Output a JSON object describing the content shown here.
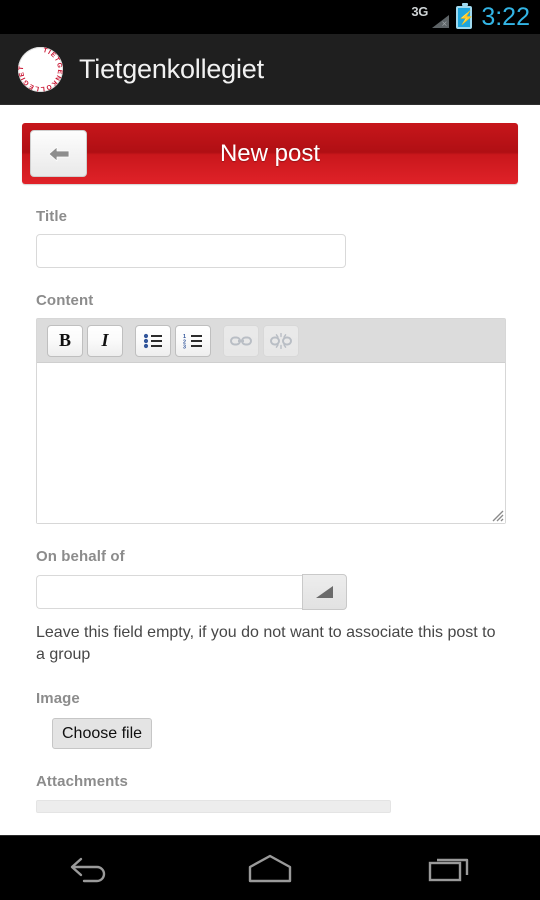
{
  "status_bar": {
    "network_label": "3G",
    "network_state_icon": "signal-no-connection-icon",
    "battery_icon": "battery-charging-icon",
    "time": "3:22",
    "time_color": "#33b5e5"
  },
  "app_bar": {
    "logo_icon": "tietgenkollegiet-logo-icon",
    "logo_text": "TIETGENKOLLEGIET",
    "title": "Tietgenkollegiet",
    "background_color": "#1f1f1f"
  },
  "page_header": {
    "title": "New post",
    "back_icon": "arrow-left-icon",
    "accent_color": "#c7161b"
  },
  "form": {
    "title_field": {
      "label": "Title",
      "value": "",
      "placeholder": ""
    },
    "content_field": {
      "label": "Content",
      "value": "",
      "toolbar": [
        {
          "name": "bold-button",
          "glyph": "B",
          "label": "Bold",
          "disabled": false
        },
        {
          "name": "italic-button",
          "glyph": "I",
          "label": "Italic",
          "disabled": false
        },
        {
          "name": "bullet-list-button",
          "glyph": "",
          "label": "Unordered list",
          "disabled": false
        },
        {
          "name": "numbered-list-button",
          "glyph": "",
          "label": "Ordered list",
          "disabled": false
        },
        {
          "name": "link-button",
          "glyph": "",
          "label": "Insert link",
          "disabled": true
        },
        {
          "name": "unlink-button",
          "glyph": "",
          "label": "Remove link",
          "disabled": true
        }
      ],
      "resize_handle_icon": "resize-grip-icon"
    },
    "on_behalf_of_field": {
      "label": "On behalf of",
      "value": "",
      "placeholder": "",
      "dropdown_icon": "dropdown-triangle-icon",
      "helper_text": "Leave this field empty, if you do not want to associate this post to a group"
    },
    "image_field": {
      "label": "Image",
      "button_label": "Choose file"
    },
    "attachments_field": {
      "label": "Attachments"
    }
  },
  "nav_bar": {
    "back_label": "Back",
    "home_label": "Home",
    "recents_label": "Recent apps",
    "back_icon": "nav-back-icon",
    "home_icon": "nav-home-icon",
    "recents_icon": "nav-recents-icon"
  }
}
